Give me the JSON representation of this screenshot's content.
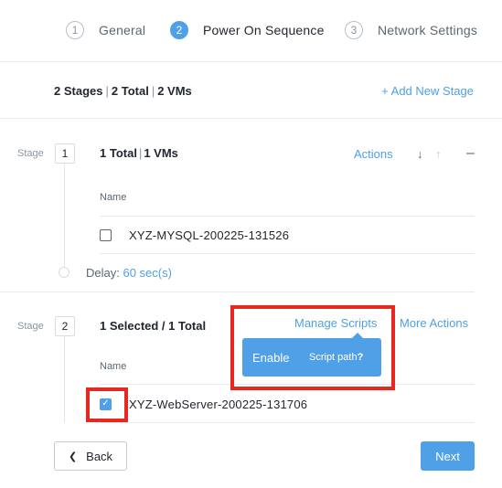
{
  "steps": [
    {
      "number": "1",
      "label": "General"
    },
    {
      "number": "2",
      "label": "Power On Sequence"
    },
    {
      "number": "3",
      "label": "Network Settings"
    }
  ],
  "summary": {
    "stages": "2 Stages",
    "total": "2 Total",
    "vms": "2 VMs",
    "add_stage": "+ Add New Stage"
  },
  "stage1": {
    "label": "Stage",
    "number": "1",
    "total": "1 Total",
    "vms": "1 VMs",
    "actions": "Actions",
    "column_name": "Name",
    "vm": "XYZ-MYSQL-200225-131526",
    "delay_label": "Delay:",
    "delay_value": "60 sec(s)"
  },
  "stage2": {
    "label": "Stage",
    "number": "2",
    "selected": "1 Selected / 1 Total",
    "manage_scripts": "Manage Scripts",
    "more_actions": "More Actions",
    "column_name": "Name",
    "vm": "XYZ-WebServer-200225-131706"
  },
  "popover": {
    "enable": "Enable",
    "script_path": "Script path",
    "help": "?"
  },
  "footer": {
    "back": "Back",
    "next": "Next"
  },
  "colors": {
    "accent": "#4fa0e6",
    "highlight": "#e8281f"
  }
}
